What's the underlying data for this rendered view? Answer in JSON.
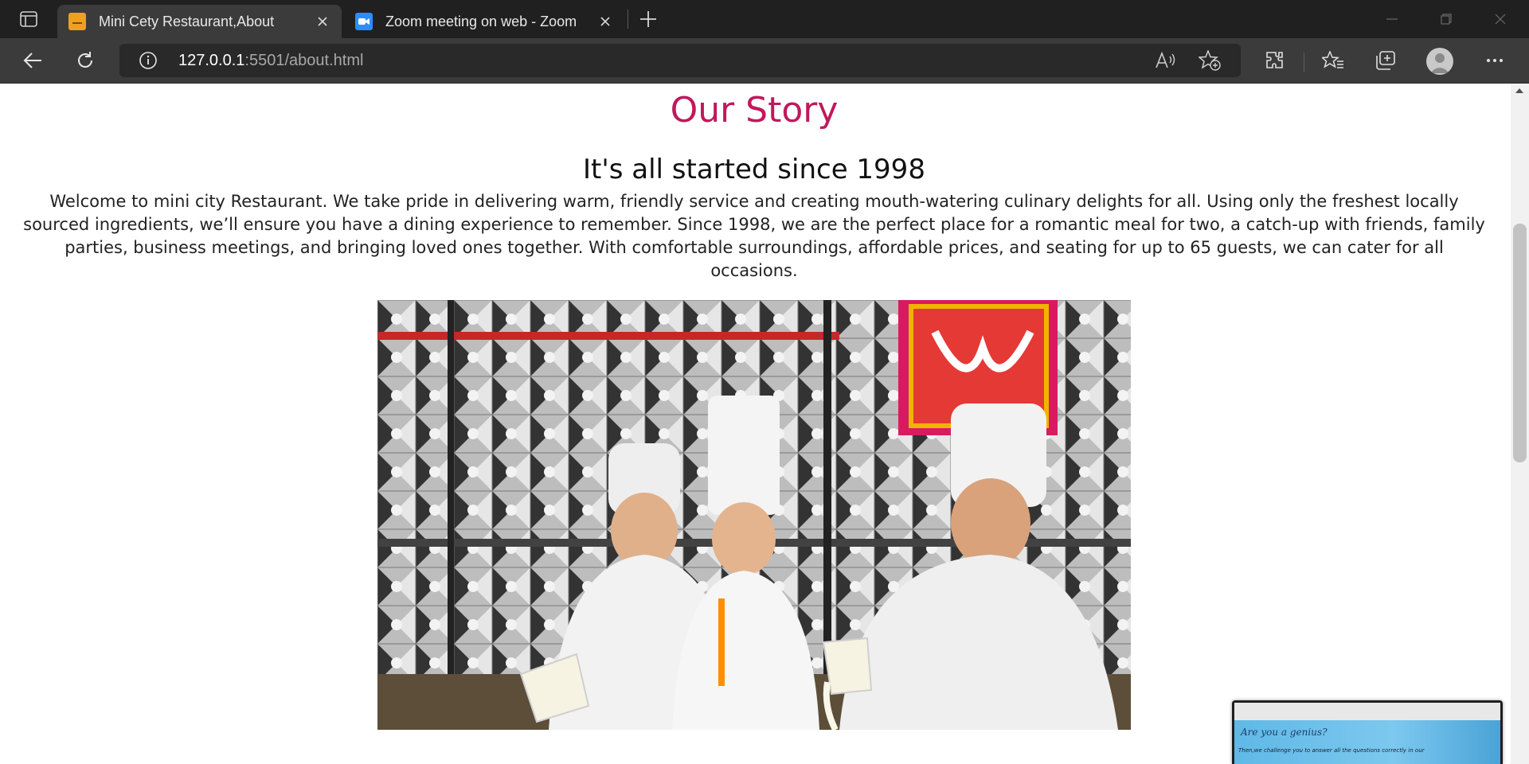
{
  "browser": {
    "tabs": [
      {
        "title": "Mini Cety Restaurant,About",
        "active": true,
        "favicon": "restaurant-favicon",
        "favicon_color": "#f0a020"
      },
      {
        "title": "Zoom meeting on web - Zoom",
        "active": false,
        "favicon": "zoom-favicon",
        "favicon_color": "#2d8cff"
      }
    ],
    "address": {
      "host": "127.0.0.1",
      "path": ":5501/about.html"
    },
    "icons": [
      "tab-actions-icon",
      "close-icon",
      "new-tab-icon",
      "minimize-icon",
      "restore-icon",
      "window-close-icon",
      "back-icon",
      "refresh-icon",
      "info-icon",
      "read-aloud-icon",
      "add-favorite-icon",
      "extensions-icon",
      "favorites-icon",
      "collections-icon",
      "profile-icon",
      "more-icon"
    ]
  },
  "page": {
    "title": "Our Story",
    "subtitle": "It's all started since 1998",
    "paragraph": "Welcome to mini city Restaurant. We take pride in delivering warm, friendly service and creating mouth-watering culinary delights for all. Using only the freshest locally sourced ingredients, we’ll ensure you have a dining experience to remember. Since 1998, we are the perfect place for a romantic meal for two, a catch-up with friends, family parties, business meetings, and bringing loved ones together. With comfortable surroundings, affordable prices, and seating for up to 65 guests, we can cater for all occasions.",
    "title_color": "#c2185b"
  },
  "preview": {
    "heading": "Are you a genius?",
    "text": "Then,we challenge you to answer all the questions correctly in our"
  }
}
